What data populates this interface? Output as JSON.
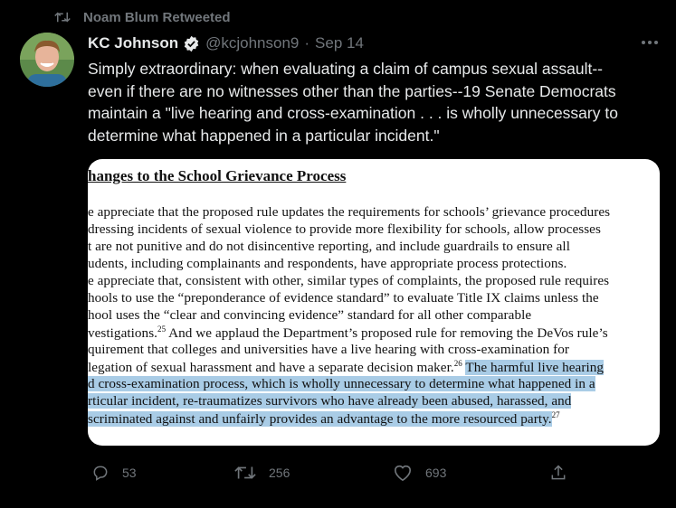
{
  "retweet": {
    "icon": "retweet-icon",
    "label": "Noam Blum Retweeted"
  },
  "author": {
    "name": "KC Johnson",
    "verified_icon": "verified-badge-icon",
    "handle": "@kcjohnson9",
    "separator": "·",
    "date": "Sep 14"
  },
  "more_icon": "more-options-icon",
  "tweet": {
    "lines": [
      "Simply extraordinary: when evaluating a claim of campus sexual assault--",
      "even if there are no witnesses other than the parties--19 Senate Democrats",
      "maintain a \"live hearing and cross-examination . . . is wholly unnecessary to",
      "determine what happened in a particular incident.\""
    ]
  },
  "document": {
    "heading": "hanges to the School Grievance Process",
    "lines": [
      "e appreciate that the proposed rule updates the requirements for schools’ grievance procedures",
      "dressing incidents of sexual violence to provide more flexibility for schools, allow processes",
      "t are not punitive and do not disincentive reporting, and include guardrails to ensure all",
      "udents, including complainants and respondents, have appropriate process protections.",
      "e appreciate that, consistent with other, similar types of complaints, the proposed rule requires",
      "hools to use the “preponderance of evidence standard” to evaluate Title IX claims unless the",
      "hool uses the “clear and convincing evidence” standard for all other comparable",
      "vestigations.",
      "25",
      " And we applaud the Department’s proposed rule for removing the DeVos rule’s",
      "quirement that colleges and universities have a live hearing with cross-examination for",
      "legation of sexual harassment and have a separate decision maker.",
      "26",
      " ",
      "The harmful live hearing",
      "d cross-examination process, which is wholly unnecessary to determine what happened in a",
      "rticular incident, re-traumatizes survivors who have already been abused, harassed, and",
      "scriminated against and unfairly provides an advantage to the more resourced party.",
      "27"
    ]
  },
  "actions": {
    "reply": {
      "icon": "reply-icon",
      "count": "53"
    },
    "retweet": {
      "icon": "retweet-icon",
      "count": "256"
    },
    "like": {
      "icon": "heart-icon",
      "count": "693"
    },
    "share": {
      "icon": "share-icon"
    }
  },
  "colors": {
    "background": "#000000",
    "text": "#e7e9ea",
    "muted": "#71767b",
    "verified": "#e7e9ea",
    "highlight": "#a9cce6"
  }
}
